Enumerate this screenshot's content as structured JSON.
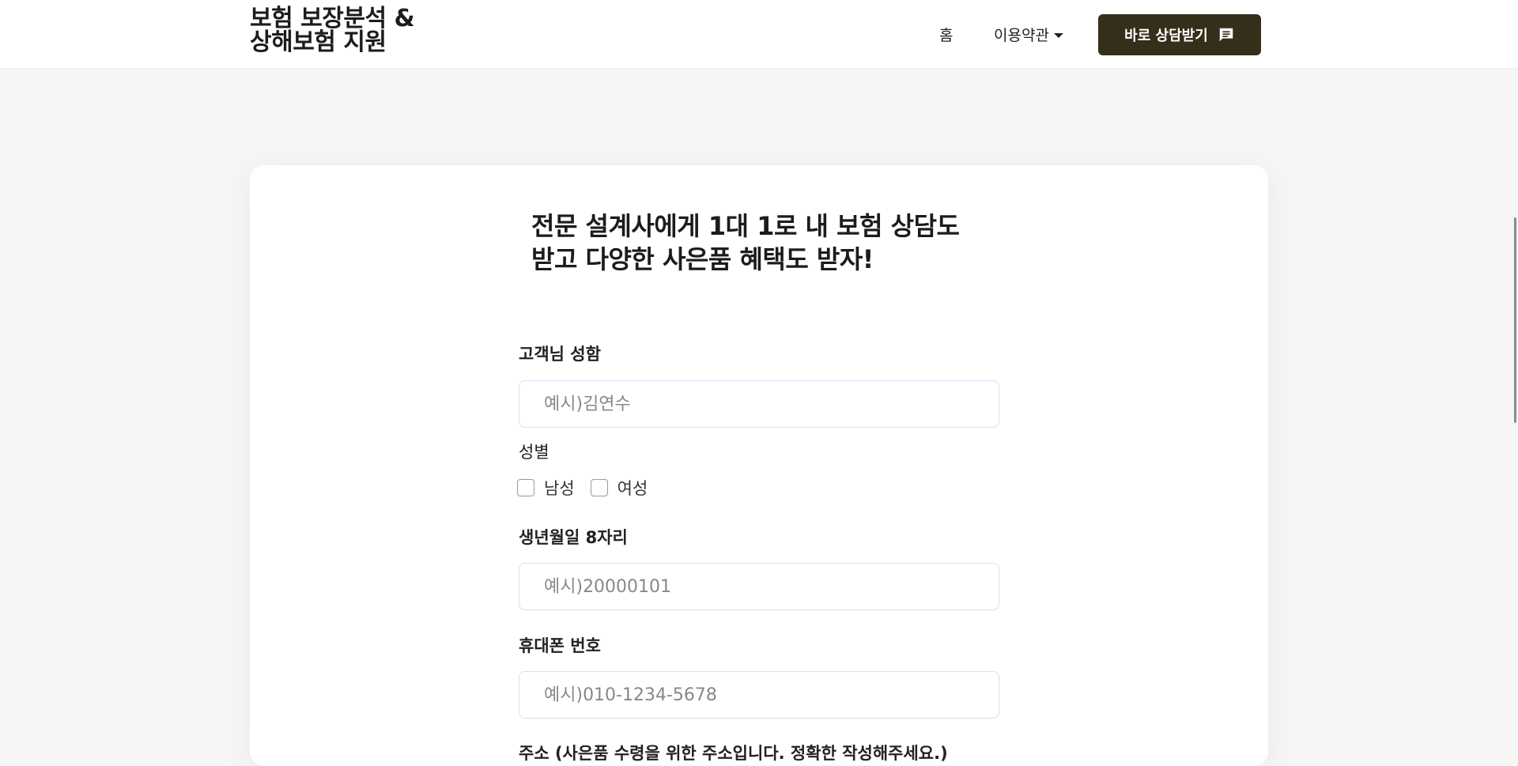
{
  "header": {
    "logo_line1": "보험 보장분석 &",
    "logo_line2": "상해보험 지원",
    "nav_home": "홈",
    "nav_terms": "이용약관",
    "cta_label": "바로 상담받기"
  },
  "form": {
    "headline_line1": "전문 설계사에게 1대 1로 내 보험 상담도",
    "headline_line2": "받고 다양한 사은품 혜택도 받자!",
    "name_label": "고객님 성함",
    "name_placeholder": "예시)김연수",
    "gender_label": "성별",
    "gender_options": [
      "남성",
      "여성"
    ],
    "birth_label": "생년월일 8자리",
    "birth_placeholder": "예시)20000101",
    "phone_label": "휴대폰 번호",
    "phone_placeholder": "예시)010-1234-5678",
    "cutoff_text": "주소 (사은품 수령을 위한 주소입니다. 정확한 작성해주세요.)"
  },
  "colors": {
    "cta_background": "#352e1b",
    "page_background": "#f6f6f6",
    "card_background": "#ffffff"
  },
  "icons": {
    "cta_icon": "chat-icon",
    "terms_dropdown": "caret-down-icon"
  }
}
